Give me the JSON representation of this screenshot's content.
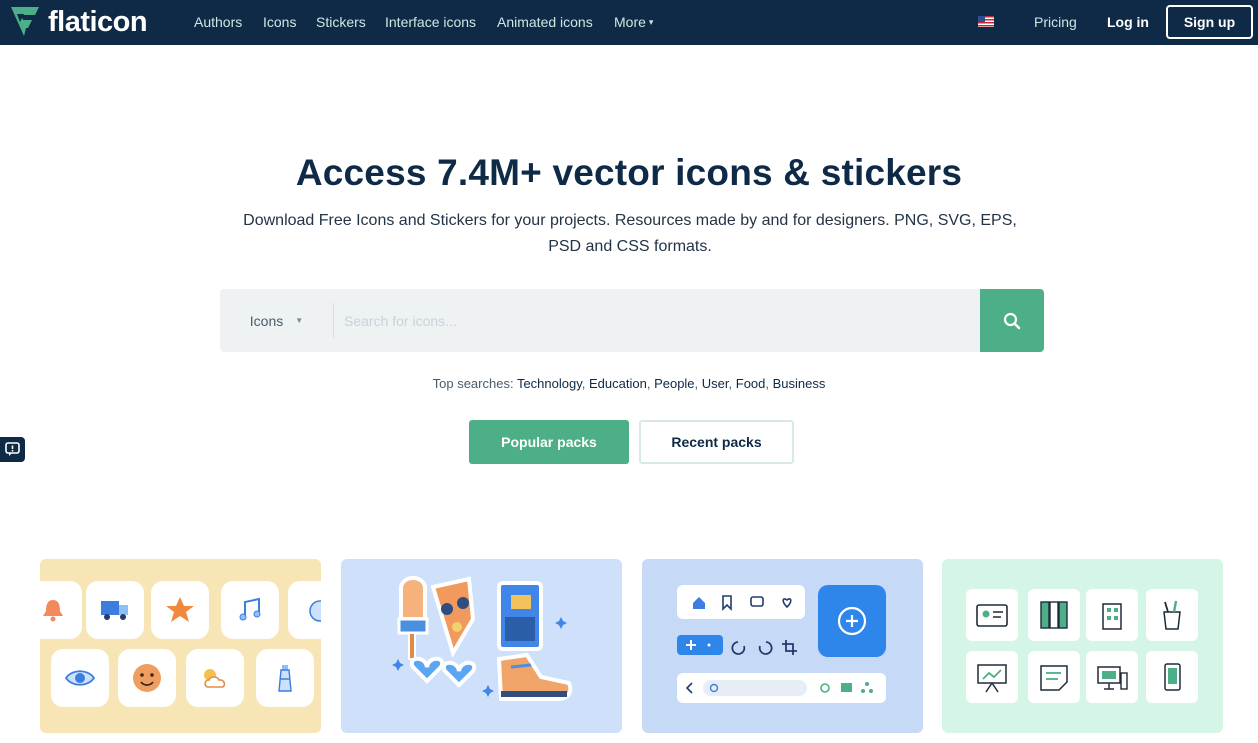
{
  "nav": {
    "brand": "flaticon",
    "links": [
      "Authors",
      "Icons",
      "Stickers",
      "Interface icons",
      "Animated icons",
      "More"
    ],
    "pricing": "Pricing",
    "login": "Log in",
    "signup": "Sign up",
    "language_flag_icon": "us-flag-icon"
  },
  "hero": {
    "headline": "Access 7.4M+ vector icons & stickers",
    "subhead": "Download Free Icons and Stickers for your projects. Resources made by and for designers. PNG, SVG, EPS, PSD and CSS formats."
  },
  "search": {
    "type_selected": "Icons",
    "placeholder": "Search for icons...",
    "button_icon": "search-icon"
  },
  "top_searches": {
    "label": "Top searches:",
    "terms": [
      "Technology",
      "Education",
      "People",
      "User",
      "Food",
      "Business"
    ]
  },
  "tabs": {
    "popular": "Popular packs",
    "recent": "Recent packs"
  },
  "colors": {
    "nav_bg": "#0e2a47",
    "accent": "#4caf87",
    "card1": "#f8e5b5",
    "card2": "#cfe0fb",
    "card3": "#c6daf7",
    "card4": "#d5f5e6"
  },
  "packs": [
    {
      "name": "colorful-ui-icons-pack",
      "icons": [
        "bell-icon",
        "truck-icon",
        "star-icon",
        "music-note-icon",
        "eye-icon",
        "smiley-icon",
        "sun-cloud-icon",
        "lighthouse-icon"
      ]
    },
    {
      "name": "food-stickers-pack",
      "icons": [
        "ice-cream-sticker",
        "pizza-sticker",
        "heart-glasses-sticker",
        "juice-box-sticker",
        "sneaker-sticker"
      ]
    },
    {
      "name": "interface-pack",
      "icons": [
        "home-icon",
        "bookmark-icon",
        "chat-icon",
        "heart-icon",
        "plus-icon",
        "undo-icon",
        "redo-icon",
        "crop-icon",
        "search-icon",
        "settings-icon",
        "mail-icon",
        "share-icon",
        "add-circle-icon"
      ]
    },
    {
      "name": "office-pack",
      "icons": [
        "id-card-icon",
        "binders-icon",
        "building-icon",
        "pencil-cup-icon",
        "presentation-icon",
        "sticky-note-icon",
        "computer-icon",
        "smartphone-icon"
      ]
    }
  ]
}
